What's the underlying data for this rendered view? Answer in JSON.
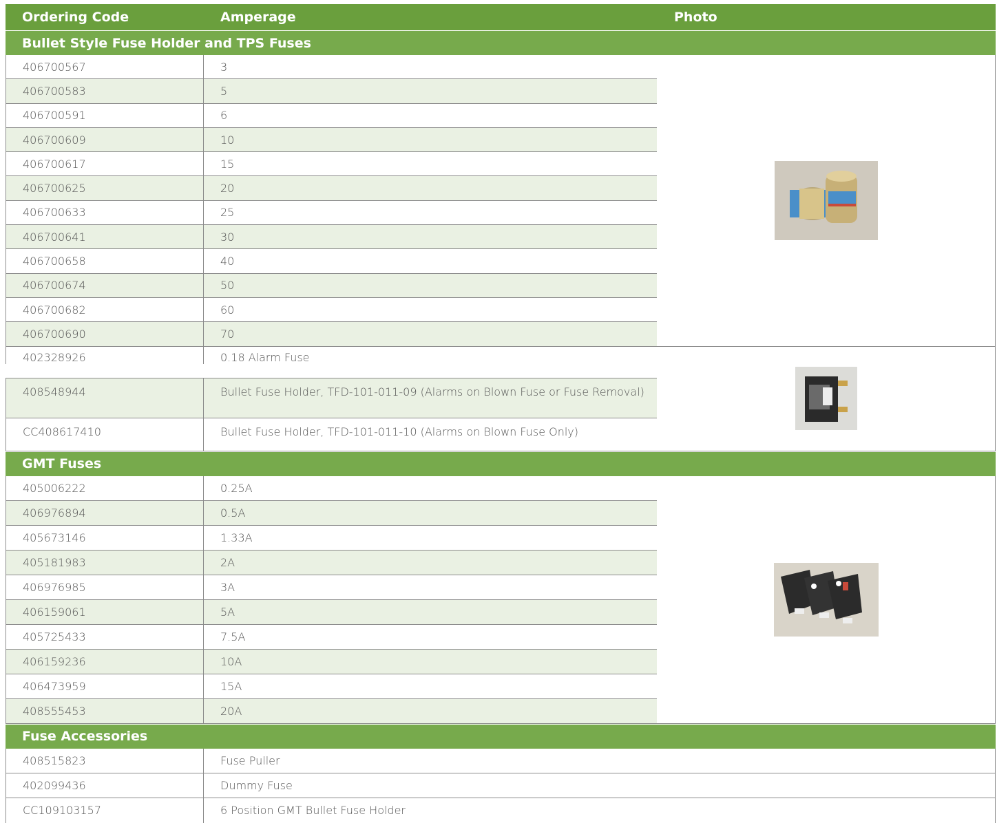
{
  "header": {
    "col1": "Ordering Code",
    "col2": "Amperage",
    "col3": "Photo"
  },
  "sections": {
    "bullet": {
      "title": "Bullet Style Fuse Holder and TPS Fuses",
      "rows": [
        {
          "code": "406700567",
          "amp": "3"
        },
        {
          "code": "406700583",
          "amp": "5"
        },
        {
          "code": "406700591",
          "amp": "6"
        },
        {
          "code": "406700609",
          "amp": "10"
        },
        {
          "code": "406700617",
          "amp": "15"
        },
        {
          "code": "406700625",
          "amp": "20"
        },
        {
          "code": "406700633",
          "amp": "25"
        },
        {
          "code": "406700641",
          "amp": "30"
        },
        {
          "code": "406700658",
          "amp": "40"
        },
        {
          "code": "406700674",
          "amp": "50"
        },
        {
          "code": "406700682",
          "amp": "60"
        },
        {
          "code": "406700690",
          "amp": "70"
        }
      ],
      "holder_rows": [
        {
          "code": "402328926",
          "amp": "0.18 Alarm Fuse"
        },
        {
          "code": "408548944",
          "amp": "Bullet Fuse Holder, TFD-101-011-09 (Alarms on Blown Fuse or Fuse Removal)"
        },
        {
          "code": "CC408617410",
          "amp": "Bullet Fuse Holder, TFD-101-011-10 (Alarms on Blown Fuse Only)"
        }
      ]
    },
    "gmt": {
      "title": "GMT Fuses",
      "rows": [
        {
          "code": "405006222",
          "amp": "0.25A"
        },
        {
          "code": "406976894",
          "amp": "0.5A"
        },
        {
          "code": "405673146",
          "amp": "1.33A"
        },
        {
          "code": "405181983",
          "amp": "2A"
        },
        {
          "code": "406976985",
          "amp": "3A"
        },
        {
          "code": "406159061",
          "amp": "5A"
        },
        {
          "code": "405725433",
          "amp": "7.5A"
        },
        {
          "code": "406159236",
          "amp": "10A"
        },
        {
          "code": "406473959",
          "amp": "15A"
        },
        {
          "code": "408555453",
          "amp": "20A"
        }
      ]
    },
    "accessories": {
      "title": "Fuse Accessories",
      "rows": [
        {
          "code": "408515823",
          "amp": "Fuse Puller"
        },
        {
          "code": "402099436",
          "amp": "Dummy Fuse"
        },
        {
          "code": "CC109103157",
          "amp": "6 Position GMT Bullet Fuse Holder"
        }
      ]
    }
  },
  "colors": {
    "header_green": "#6a9f3d",
    "section_green": "#77aa4c",
    "alt_row": "#eaf1e3"
  }
}
